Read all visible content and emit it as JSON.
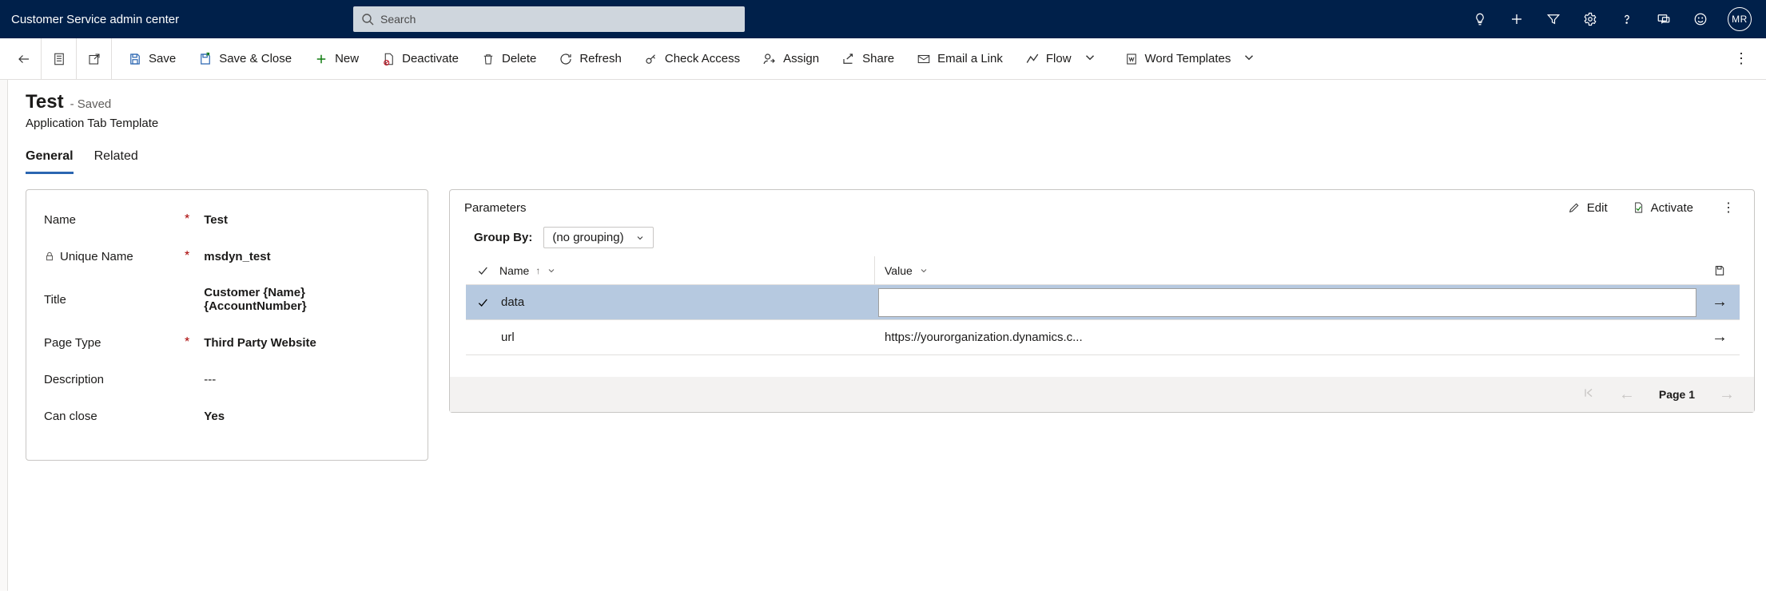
{
  "app_title": "Customer Service admin center",
  "search_placeholder": "Search",
  "avatar_initials": "MR",
  "commands": {
    "save": "Save",
    "save_close": "Save & Close",
    "new": "New",
    "deactivate": "Deactivate",
    "delete": "Delete",
    "refresh": "Refresh",
    "check_access": "Check Access",
    "assign": "Assign",
    "share": "Share",
    "email_link": "Email a Link",
    "flow": "Flow",
    "word_templates": "Word Templates"
  },
  "record": {
    "name": "Test",
    "status_suffix": "- Saved",
    "entity": "Application Tab Template"
  },
  "tabs": {
    "general": "General",
    "related": "Related"
  },
  "form": {
    "labels": {
      "name": "Name",
      "unique_name": "Unique Name",
      "title": "Title",
      "page_type": "Page Type",
      "description": "Description",
      "can_close": "Can close"
    },
    "values": {
      "name": "Test",
      "unique_name": "msdyn_test",
      "title": "Customer {Name} {AccountNumber}",
      "page_type": "Third Party Website",
      "description": "---",
      "can_close": "Yes"
    }
  },
  "params": {
    "title": "Parameters",
    "edit": "Edit",
    "activate": "Activate",
    "group_by_label": "Group By:",
    "group_by_value": "(no grouping)",
    "columns": {
      "name": "Name",
      "value": "Value"
    },
    "rows": [
      {
        "name": "data",
        "value": "",
        "selected": true
      },
      {
        "name": "url",
        "value": "https://yourorganization.dynamics.c...",
        "selected": false
      }
    ],
    "page_label": "Page 1"
  }
}
